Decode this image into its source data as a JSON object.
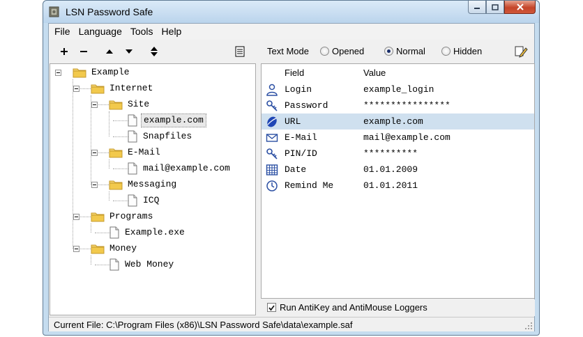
{
  "window": {
    "title": "LSN Password Safe"
  },
  "menu": {
    "items": [
      "File",
      "Language",
      "Tools",
      "Help"
    ]
  },
  "toolbar": {
    "add": "+",
    "remove": "−"
  },
  "tree": {
    "nodes": [
      {
        "label": "Example",
        "type": "folder"
      },
      {
        "label": "Internet",
        "type": "folder"
      },
      {
        "label": "Site",
        "type": "folder"
      },
      {
        "label": "example.com",
        "type": "entry",
        "selected": true
      },
      {
        "label": "Snapfiles",
        "type": "entry"
      },
      {
        "label": "E-Mail",
        "type": "folder"
      },
      {
        "label": "mail@example.com",
        "type": "entry"
      },
      {
        "label": "Messaging",
        "type": "folder"
      },
      {
        "label": "ICQ",
        "type": "entry"
      },
      {
        "label": "Programs",
        "type": "folder"
      },
      {
        "label": "Example.exe",
        "type": "entry"
      },
      {
        "label": "Money",
        "type": "folder"
      },
      {
        "label": "Web Money",
        "type": "entry"
      }
    ]
  },
  "textmode": {
    "label": "Text Mode",
    "options": [
      "Opened",
      "Normal",
      "Hidden"
    ],
    "selected": "Normal"
  },
  "fields": {
    "header": {
      "field": "Field",
      "value": "Value"
    },
    "rows": [
      {
        "name": "Login",
        "value": "example_login",
        "icon": "user-icon"
      },
      {
        "name": "Password",
        "value": "****************",
        "icon": "key-icon"
      },
      {
        "name": "URL",
        "value": "example.com",
        "icon": "globe-icon",
        "selected": true
      },
      {
        "name": "E-Mail",
        "value": "mail@example.com",
        "icon": "envelope-icon"
      },
      {
        "name": "PIN/ID",
        "value": "**********",
        "icon": "key-icon"
      },
      {
        "name": "Date",
        "value": "01.01.2009",
        "icon": "calendar-icon"
      },
      {
        "name": "Remind Me",
        "value": "01.01.2011",
        "icon": "clock-icon"
      }
    ]
  },
  "antilogger": {
    "label": "Run AntiKey and AntiMouse Loggers",
    "checked": true
  },
  "status": {
    "text": "Current File: C:\\Program Files (x86)\\LSN Password Safe\\data\\example.saf"
  },
  "colors": {
    "selected_row": "#cfe0ef",
    "folder": "#f2c94c"
  }
}
